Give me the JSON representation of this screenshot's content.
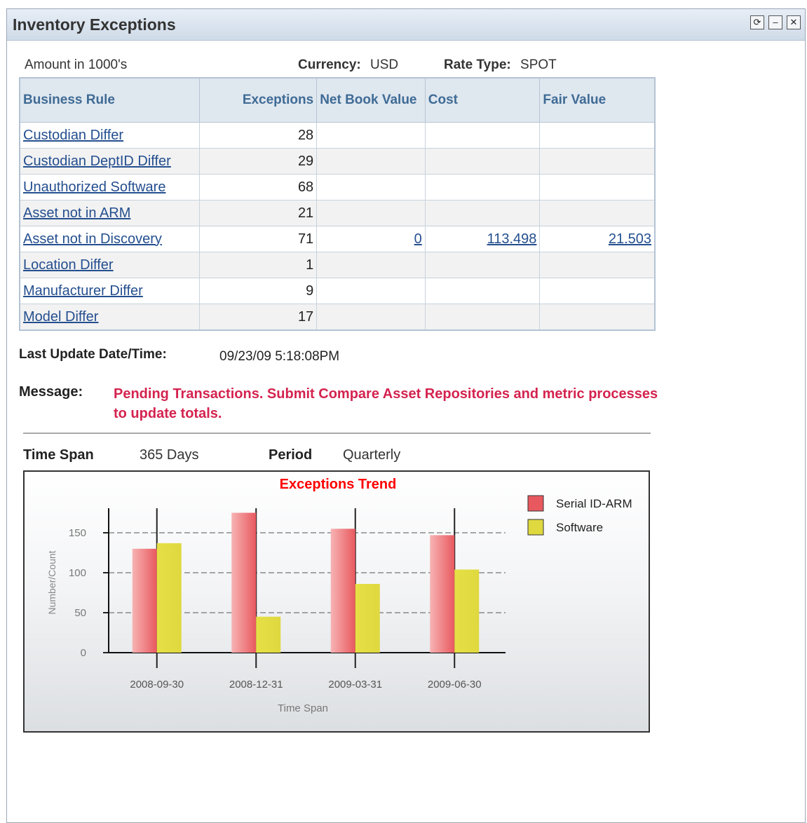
{
  "portlet": {
    "title": "Inventory Exceptions",
    "buttons": [
      {
        "name": "refresh-icon",
        "glyph": "⟳"
      },
      {
        "name": "minimize-icon",
        "glyph": "–"
      },
      {
        "name": "close-icon",
        "glyph": "✕"
      }
    ]
  },
  "header_info": {
    "amount_note": "Amount in 1000's",
    "currency_label": "Currency:",
    "currency_value": "USD",
    "rate_type_label": "Rate Type:",
    "rate_type_value": "SPOT"
  },
  "table": {
    "columns": [
      "Business Rule",
      "Exceptions",
      "Net Book Value",
      "Cost",
      "Fair Value"
    ],
    "rows": [
      {
        "rule": "Custodian Differ",
        "exceptions": "28",
        "nbv": "",
        "cost": "",
        "fair": ""
      },
      {
        "rule": "Custodian DeptID Differ",
        "exceptions": "29",
        "nbv": "",
        "cost": "",
        "fair": ""
      },
      {
        "rule": "Unauthorized Software",
        "exceptions": "68",
        "nbv": "",
        "cost": "",
        "fair": ""
      },
      {
        "rule": "Asset not in ARM",
        "exceptions": "21",
        "nbv": "",
        "cost": "",
        "fair": ""
      },
      {
        "rule": "Asset not in Discovery",
        "exceptions": "71",
        "nbv": "0",
        "cost": "113.498",
        "fair": "21.503"
      },
      {
        "rule": "Location Differ",
        "exceptions": "1",
        "nbv": "",
        "cost": "",
        "fair": ""
      },
      {
        "rule": "Manufacturer Differ",
        "exceptions": "9",
        "nbv": "",
        "cost": "",
        "fair": ""
      },
      {
        "rule": "Model Differ",
        "exceptions": "17",
        "nbv": "",
        "cost": "",
        "fair": ""
      }
    ]
  },
  "last_update": {
    "label": "Last Update Date/Time:",
    "value": "09/23/09  5:18:08PM"
  },
  "message": {
    "label": "Message:",
    "text": "Pending Transactions. Submit Compare Asset Repositories and metric processes to update totals."
  },
  "span": {
    "time_span_label": "Time Span",
    "time_span_value": "365 Days",
    "period_label": "Period",
    "period_value": "Quarterly"
  },
  "colors": {
    "serial": "#e8595f",
    "software": "#dfd83f",
    "title": "#ff0000",
    "link": "#244f8f",
    "message": "#d4234f"
  },
  "chart_data": {
    "type": "bar",
    "title": "Exceptions Trend",
    "xlabel": "Time Span",
    "ylabel": "Number/Count",
    "categories": [
      "2008-09-30",
      "2008-12-31",
      "2009-03-31",
      "2009-06-30"
    ],
    "series": [
      {
        "name": "Serial ID-ARM",
        "values": [
          130,
          175,
          155,
          147
        ]
      },
      {
        "name": "Software",
        "values": [
          137,
          45,
          86,
          104
        ]
      }
    ],
    "yticks": [
      0,
      50,
      100,
      150
    ],
    "ylim": [
      0,
      180
    ],
    "grid": true,
    "legend": "right"
  }
}
